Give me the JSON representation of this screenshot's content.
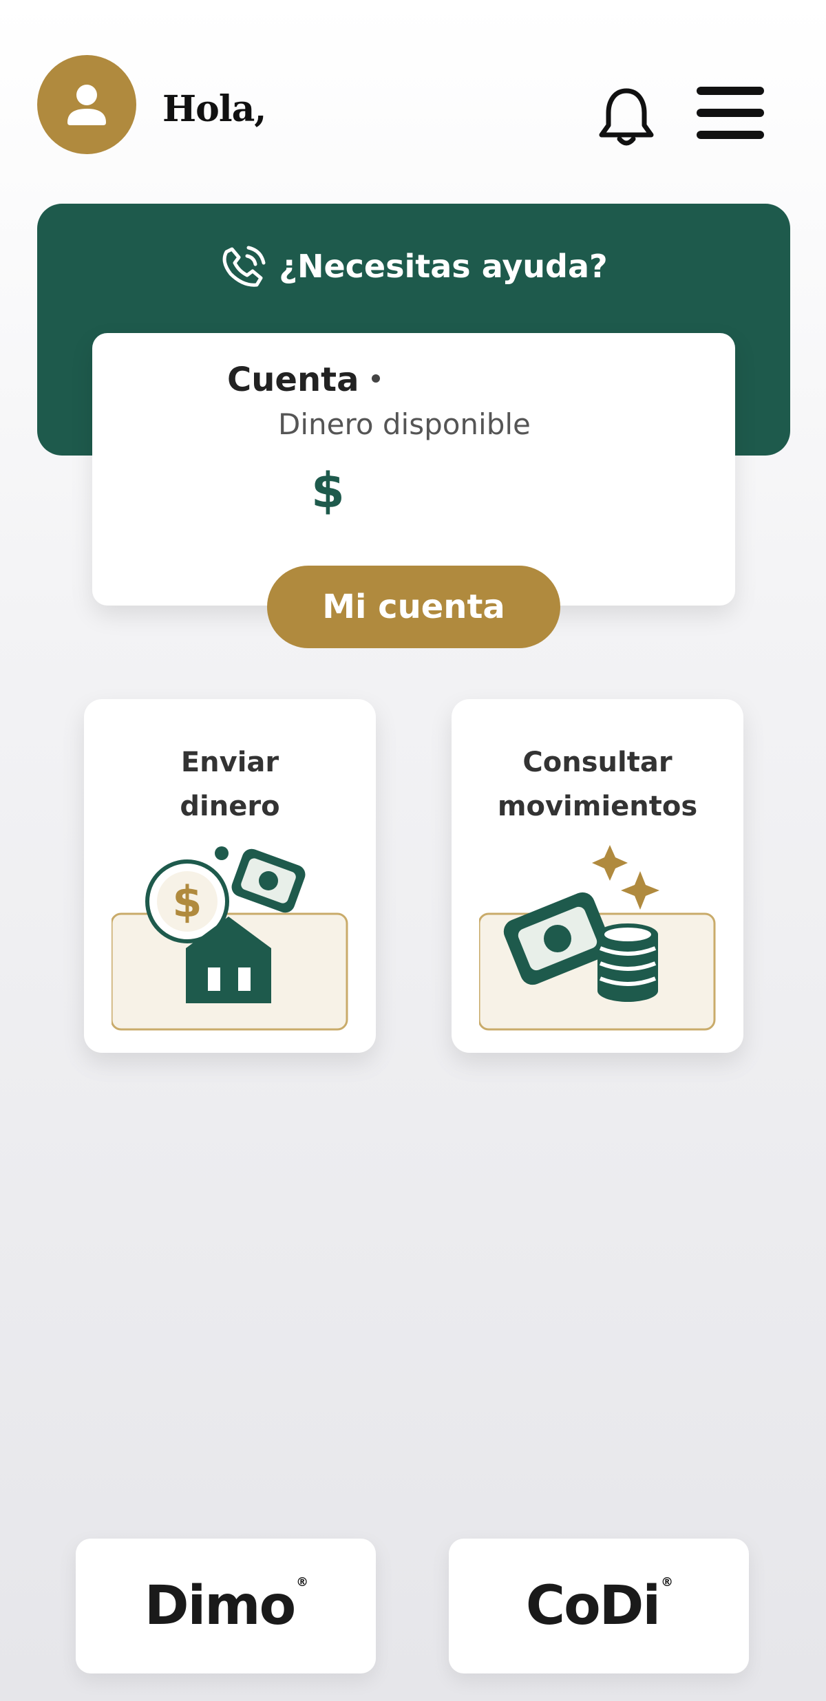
{
  "header": {
    "greeting": "Hola,",
    "avatar_icon": "user-avatar-icon",
    "notifications_icon": "bell-icon",
    "menu_icon": "hamburger-menu-icon"
  },
  "help": {
    "label": "¿Necesitas ayuda?",
    "icon": "phone-call-icon"
  },
  "account": {
    "title": "Cuenta",
    "subtitle": "Dinero disponible",
    "amount": "$",
    "button_label": "Mi cuenta"
  },
  "actions": [
    {
      "label_line1": "Enviar",
      "label_line2": "dinero",
      "icon": "bank-money-illustration"
    },
    {
      "label_line1": "Consultar",
      "label_line2": "movimientos",
      "icon": "bill-coins-illustration"
    }
  ],
  "logos": {
    "dimo": "Dimo",
    "codi": "CoDi",
    "registered_mark": "®"
  },
  "colors": {
    "primary_green": "#1e5a4c",
    "accent_gold": "#b08a3e",
    "tile_cream": "#f7f2e7"
  }
}
